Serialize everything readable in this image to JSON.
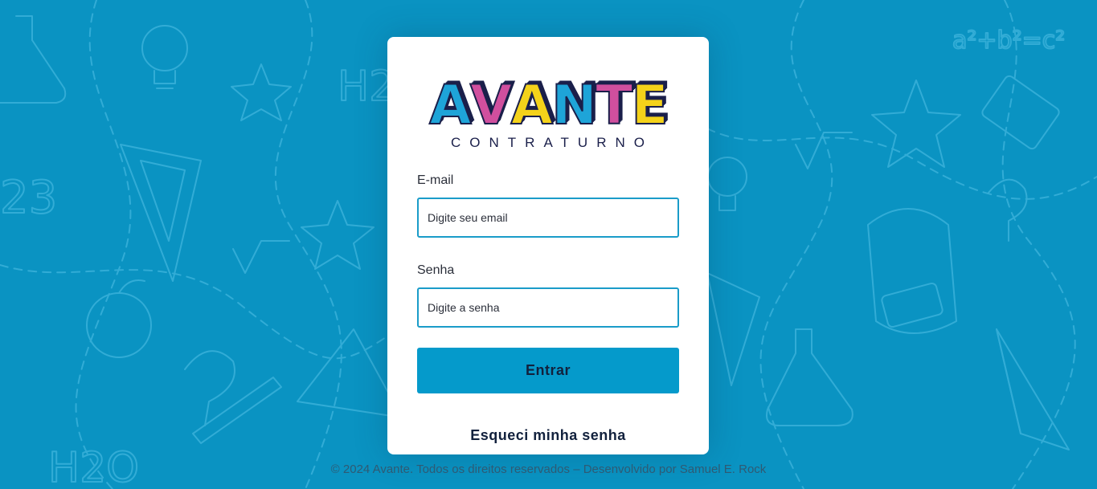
{
  "logo": {
    "letters": [
      "A",
      "V",
      "A",
      "N",
      "T",
      "E"
    ],
    "letter_colors": [
      "#1ea4d8",
      "#d04f9e",
      "#f4d21a",
      "#1ea4d8",
      "#d04f9e",
      "#f4d21a"
    ],
    "subtitle": "CONTRATURNO"
  },
  "form": {
    "email_label": "E-mail",
    "email_placeholder": "Digite seu email",
    "password_label": "Senha",
    "password_placeholder": "Digite a senha",
    "submit_label": "Entrar",
    "forgot_label": "Esqueci minha senha"
  },
  "footer": {
    "text": "© 2024 Avante. Todos os direitos reservados – Desenvolvido por Samuel E. Rock"
  },
  "colors": {
    "background": "#0a93c2",
    "accent": "#059acb",
    "input_border": "#1a9cc9",
    "text_dark": "#12213d"
  }
}
